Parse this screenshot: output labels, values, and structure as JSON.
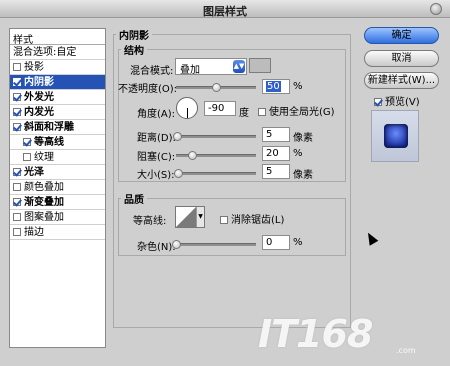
{
  "window": {
    "title": "图层样式"
  },
  "sidebar": {
    "header": "样式",
    "blend_options": "混合选项:自定",
    "items": [
      {
        "label": "投影",
        "checked": false
      },
      {
        "label": "内阴影",
        "checked": true,
        "selected": true
      },
      {
        "label": "外发光",
        "checked": true
      },
      {
        "label": "内发光",
        "checked": true
      },
      {
        "label": "斜面和浮雕",
        "checked": true
      },
      {
        "label": "等高线",
        "checked": true,
        "sub": true
      },
      {
        "label": "纹理",
        "checked": false,
        "sub": true
      },
      {
        "label": "光泽",
        "checked": true
      },
      {
        "label": "颜色叠加",
        "checked": false
      },
      {
        "label": "渐变叠加",
        "checked": true
      },
      {
        "label": "图案叠加",
        "checked": false
      },
      {
        "label": "描边",
        "checked": false
      }
    ]
  },
  "panel": {
    "title": "内阴影",
    "structure": {
      "legend": "结构",
      "blend_mode_label": "混合模式:",
      "blend_mode_value": "叠加",
      "opacity_label": "不透明度(O):",
      "opacity_value": "50",
      "opacity_unit": "%",
      "angle_label": "角度(A):",
      "angle_value": "-90",
      "angle_unit": "度",
      "global_light_label": "使用全局光(G)",
      "global_light_checked": false,
      "distance_label": "距离(D):",
      "distance_value": "5",
      "distance_unit": "像素",
      "choke_label": "阻塞(C):",
      "choke_value": "20",
      "choke_unit": "%",
      "size_label": "大小(S):",
      "size_value": "5",
      "size_unit": "像素"
    },
    "quality": {
      "legend": "品质",
      "contour_label": "等高线:",
      "anti_alias_label": "消除锯齿(L)",
      "anti_alias_checked": false,
      "noise_label": "杂色(N):",
      "noise_value": "0",
      "noise_unit": "%"
    }
  },
  "buttons": {
    "ok": "确定",
    "cancel": "取消",
    "new_style": "新建样式(W)...",
    "preview_label": "预览(V)",
    "preview_checked": true
  },
  "watermark": {
    "text": "IT168",
    "sub": ".com"
  }
}
